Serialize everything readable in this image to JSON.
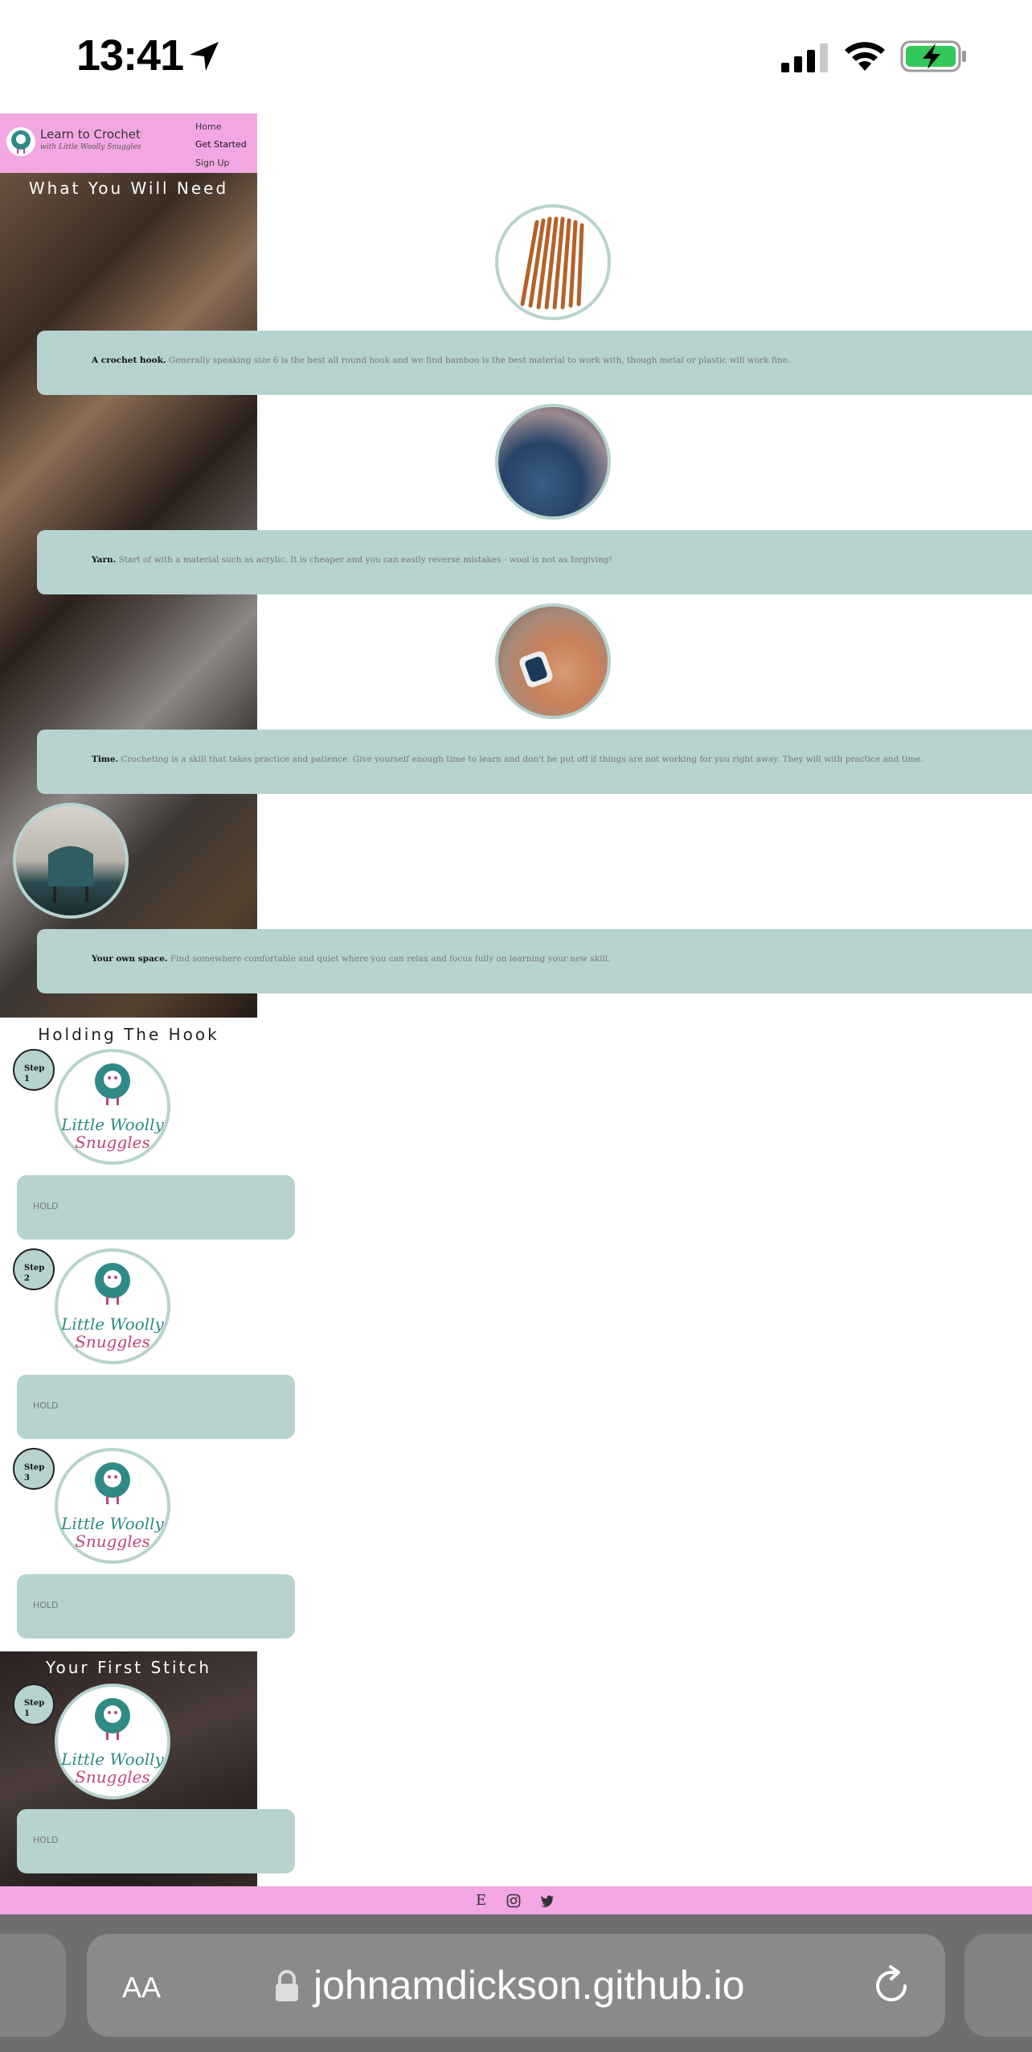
{
  "status_bar": {
    "time": "13:41"
  },
  "header": {
    "brand": "Learn to Crochet",
    "brand_sub": "with Little Woolly Snuggles",
    "nav": [
      "Home",
      "Get Started",
      "Sign Up"
    ]
  },
  "sections": {
    "needs_title": "What You Will Need",
    "holding_title": "Holding The Hook",
    "first_stitch_title": "Your First Stitch"
  },
  "needs": [
    {
      "bold": "A crochet hook.",
      "text": " Generally speaking size 6 is the best all round hook and we find bamboo is the best material to work with, though metal or plastic will work fine."
    },
    {
      "bold": "Yarn.",
      "text": " Start of with a material such as acrylic. It is cheaper and you can easily reverse mistakes - wool is not as forgiving!"
    },
    {
      "bold": "Time.",
      "text": " Crocheting is a skill that takes practice and patience. Give yourself enough time to learn and don't be put off if things are not working for you right away. They will with practice and time."
    },
    {
      "bold": "Your own space.",
      "text": " Find somewhere comfortable and quiet where you can relax and focus fully on learning your new skill."
    }
  ],
  "steps": {
    "step_word": "Step",
    "hold_label": "HOLD",
    "logo_line1": "Little Woolly",
    "logo_line2": "Snuggles",
    "holding": [
      "1",
      "2",
      "3"
    ],
    "first_stitch": [
      "1"
    ]
  },
  "footer": {
    "icons": [
      "etsy-icon",
      "instagram-icon",
      "twitter-icon"
    ],
    "etsy_letter": "E"
  },
  "browser": {
    "aa": "AA",
    "url": "johnamdickson.github.io"
  },
  "colors": {
    "pink": "#f3a7e2",
    "teal": "#b6d3cf",
    "logo_teal": "#2f8a86",
    "logo_pink": "#c0457a"
  }
}
